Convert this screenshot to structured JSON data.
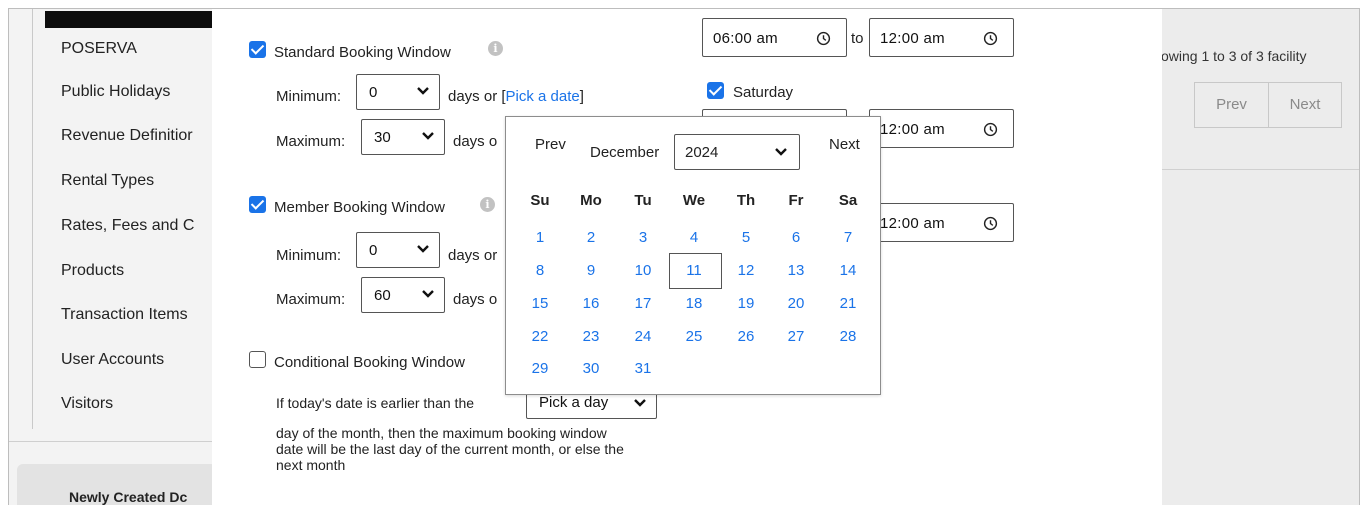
{
  "sidebar": {
    "items": [
      "POSERVA",
      "Public Holidays",
      "Revenue Definitior",
      "Rental Types",
      "Rates, Fees and C",
      "Products",
      "Transaction Items",
      "User Accounts",
      "Visitors"
    ],
    "card_title": "Newly Created Dc"
  },
  "background": {
    "showing": "owing 1 to 3 of 3 facility",
    "prev": "Prev",
    "next": "Next"
  },
  "standard": {
    "label": "Standard Booking Window",
    "checked": true,
    "min_label": "Minimum:",
    "min_value": "0",
    "max_label": "Maximum:",
    "max_value": "30",
    "days_or": "days or [",
    "pick_date": "Pick a date",
    "close_bracket": "]",
    "days_or_cut": "days o"
  },
  "member": {
    "label": "Member Booking Window",
    "checked": true,
    "min_label": "Minimum:",
    "min_value": "0",
    "max_label": "Maximum:",
    "max_value": "60",
    "days_or_cut": "days or",
    "days_o_cut": "days o"
  },
  "conditional": {
    "label": "Conditional Booking Window",
    "checked": false,
    "line1": "If today's date is earlier than the",
    "day_select": "Pick a day",
    "description": "day of the month, then the maximum booking window date will be the last day of the current month, or else the next month"
  },
  "times": {
    "start": "06:00 am",
    "to": "to",
    "end1": "12:00 am",
    "saturday_label": "Saturday",
    "end2": "12:00 am",
    "end3": "12:00 am"
  },
  "datepicker": {
    "prev": "Prev",
    "next": "Next",
    "month": "December",
    "year": "2024",
    "weekdays": [
      "Su",
      "Mo",
      "Tu",
      "We",
      "Th",
      "Fr",
      "Sa"
    ],
    "days": [
      "1",
      "2",
      "3",
      "4",
      "5",
      "6",
      "7",
      "8",
      "9",
      "10",
      "11",
      "12",
      "13",
      "14",
      "15",
      "16",
      "17",
      "18",
      "19",
      "20",
      "21",
      "22",
      "23",
      "24",
      "25",
      "26",
      "27",
      "28",
      "29",
      "30",
      "31"
    ],
    "today": "11"
  },
  "colors": {
    "accent": "#1a73e8",
    "link": "#1a73e8"
  }
}
